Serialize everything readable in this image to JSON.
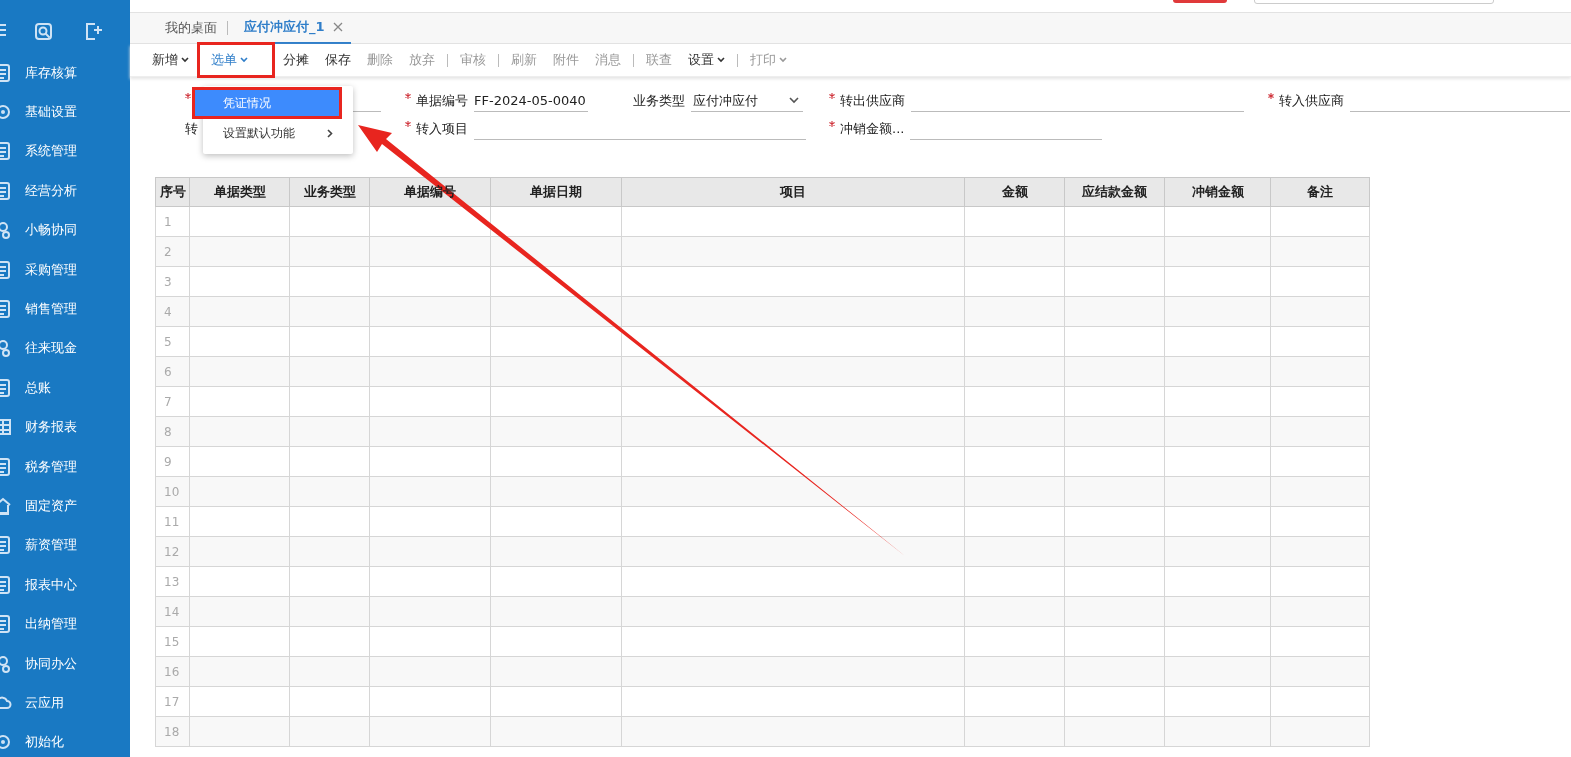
{
  "sidebar": {
    "items": [
      {
        "label": "库存核算"
      },
      {
        "label": "基础设置"
      },
      {
        "label": "系统管理"
      },
      {
        "label": "经营分析"
      },
      {
        "label": "小畅协同"
      },
      {
        "label": "采购管理"
      },
      {
        "label": "销售管理"
      },
      {
        "label": "往来现金"
      },
      {
        "label": "总账"
      },
      {
        "label": "财务报表"
      },
      {
        "label": "税务管理"
      },
      {
        "label": "固定资产"
      },
      {
        "label": "薪资管理"
      },
      {
        "label": "报表中心"
      },
      {
        "label": "出纳管理"
      },
      {
        "label": "协同办公"
      },
      {
        "label": "云应用"
      },
      {
        "label": "初始化"
      }
    ]
  },
  "tabs": [
    {
      "label": "我的桌面",
      "selected": false,
      "closable": false
    },
    {
      "label": "应付冲应付_1",
      "selected": true,
      "closable": true
    }
  ],
  "toolbar": [
    {
      "kind": "button",
      "label": "新增",
      "disabled": false,
      "dropdown": true,
      "highlighted": false,
      "selected": false
    },
    {
      "kind": "button",
      "label": "选单",
      "disabled": false,
      "dropdown": true,
      "highlighted": true,
      "selected": true
    },
    {
      "kind": "button",
      "label": "分摊",
      "disabled": false,
      "dropdown": false,
      "highlighted": false,
      "selected": false
    },
    {
      "kind": "button",
      "label": "保存",
      "disabled": false,
      "dropdown": false,
      "highlighted": false,
      "selected": false
    },
    {
      "kind": "button",
      "label": "删除",
      "disabled": true,
      "dropdown": false,
      "highlighted": false,
      "selected": false
    },
    {
      "kind": "button",
      "label": "放弃",
      "disabled": true,
      "dropdown": false,
      "highlighted": false,
      "selected": false
    },
    {
      "kind": "separator"
    },
    {
      "kind": "button",
      "label": "审核",
      "disabled": true,
      "dropdown": false,
      "highlighted": false,
      "selected": false
    },
    {
      "kind": "separator"
    },
    {
      "kind": "button",
      "label": "刷新",
      "disabled": true,
      "dropdown": false,
      "highlighted": false,
      "selected": false
    },
    {
      "kind": "button",
      "label": "附件",
      "disabled": true,
      "dropdown": false,
      "highlighted": false,
      "selected": false
    },
    {
      "kind": "button",
      "label": "消息",
      "disabled": true,
      "dropdown": false,
      "highlighted": false,
      "selected": false
    },
    {
      "kind": "separator"
    },
    {
      "kind": "button",
      "label": "联查",
      "disabled": true,
      "dropdown": false,
      "highlighted": false,
      "selected": false
    },
    {
      "kind": "button",
      "label": "设置",
      "disabled": false,
      "dropdown": true,
      "highlighted": false,
      "selected": false
    },
    {
      "kind": "separator"
    },
    {
      "kind": "button",
      "label": "打印",
      "disabled": true,
      "dropdown": true,
      "highlighted": false,
      "selected": false
    }
  ],
  "dropdown_menu": {
    "items": [
      {
        "label": "凭证情况",
        "selected": true,
        "highlighted": true,
        "submenu": false
      },
      {
        "label": "设置默认功能",
        "selected": false,
        "highlighted": false,
        "submenu": true
      }
    ]
  },
  "form": {
    "fields": [
      {
        "kind": "text",
        "required": true
      },
      {
        "kind": "text",
        "label": "单据编号",
        "required": true,
        "value": "FF-2024-05-0040"
      },
      {
        "kind": "select",
        "label": "业务类型",
        "required": false,
        "value": "应付冲应付"
      },
      {
        "kind": "text",
        "label": "转出供应商",
        "required": true
      },
      {
        "kind": "text",
        "label": "转入供应商",
        "required": true
      },
      {
        "kind": "label",
        "label": "转",
        "required": false
      },
      {
        "kind": "text",
        "label": "转入项目",
        "required": true
      },
      {
        "kind": "text",
        "label": "冲销金额...",
        "required": true
      }
    ]
  },
  "table": {
    "columns": [
      "序号",
      "单据类型",
      "业务类型",
      "单据编号",
      "单据日期",
      "项目",
      "金额",
      "应结款金额",
      "冲销金额",
      "备注"
    ],
    "row_numbers": [
      "1",
      "2",
      "3",
      "4",
      "5",
      "6",
      "7",
      "8",
      "9",
      "10",
      "11",
      "12",
      "13",
      "14",
      "15",
      "16",
      "17",
      "18"
    ]
  }
}
